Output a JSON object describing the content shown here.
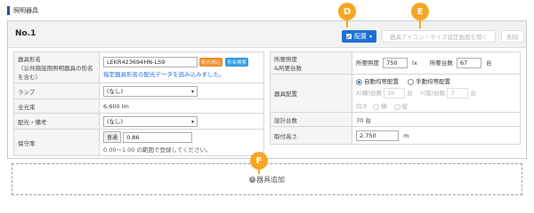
{
  "section_title": "照明器具",
  "card": {
    "title": "No.1",
    "place_button": "配置",
    "icon_size_button": "器具アイコン・サイズ設定画面を開く",
    "delete_button": "削除"
  },
  "markers": {
    "d": "D",
    "e": "E",
    "f": "F"
  },
  "left_table": {
    "fixture_label": "器具形名\n（公共施設用照明器具の形名を含む）",
    "fixture_value": "LEKR423694HN-LS9",
    "fixture_tag_light": "配光読込",
    "fixture_tag_search": "形名検索",
    "fixture_note": "指定器具形名の配光データを読み込みました。",
    "lamp_label": "ランプ",
    "lamp_value": "(なし)",
    "flux_label": "全光束",
    "flux_value": "6,600 lm",
    "remarks_label": "配光・備考",
    "remarks_value": "(なし)",
    "maint_label": "保守率",
    "maint_button": "普通",
    "maint_value": "0.86",
    "maint_hint": "0.00～1.00 の範囲で登録してください。"
  },
  "right_table": {
    "req_label": "所要照度\n&所要台数",
    "req_lux_label": "所要照度",
    "req_lux_value": "750",
    "req_lux_unit": "lx",
    "req_count_label": "所要台数",
    "req_count_value": "67",
    "req_count_unit": "台",
    "layout_label": "器具配置",
    "layout_auto": "自動均等配置",
    "layout_manual": "手動均等配置",
    "layout_x_label": "X(横)台数",
    "layout_x_value": "10",
    "layout_y_label": "Y(縦)台数",
    "layout_y_value": "7",
    "layout_unit": "台",
    "orient_label": "向き",
    "orient_h": "横",
    "orient_v": "縦",
    "count_label": "設計台数",
    "count_value": "70 台",
    "height_label": "取付高さ",
    "height_value": "2.750",
    "height_unit": "m"
  },
  "add_area": {
    "label": "器具追加"
  },
  "colors": {
    "accent": "#1f6fd6",
    "marker": "#f5a623",
    "title_bar": "#1f4e9c"
  }
}
